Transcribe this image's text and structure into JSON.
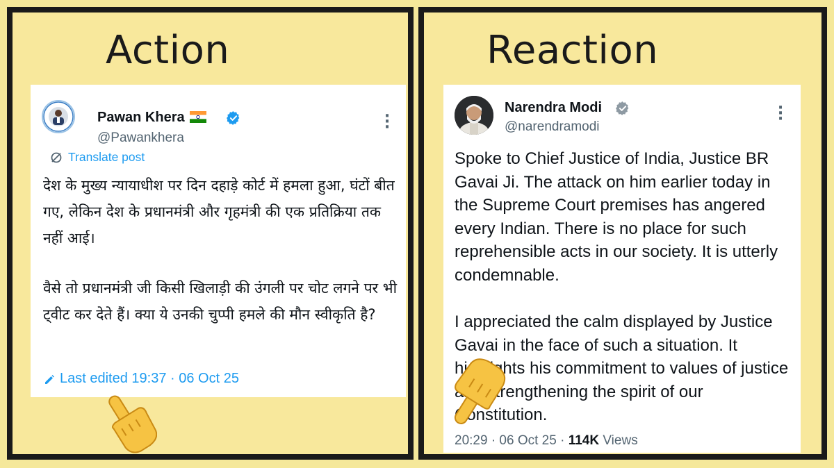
{
  "left": {
    "heading": "Action",
    "tweet": {
      "name": "Pawan Khera",
      "flag_emoji": "🇮🇳",
      "handle": "@Pawankhera",
      "translate_label": "Translate post",
      "paragraphs": [
        "देश के मुख्य न्यायाधीश पर दिन दहाड़े कोर्ट में हमला हुआ, घंटों बीत गए, लेकिन देश के प्रधानमंत्री और गृहमंत्री की एक प्रतिक्रिया तक नहीं आई।",
        "वैसे तो प्रधानमंत्री जी किसी खिलाड़ी की उंगली पर चोट लगने पर भी ट्वीट कर देते हैं। क्या ये उनकी चुप्पी हमले की मौन स्वीकृति है?"
      ],
      "edited_label": "Last edited 19:37 · 06 Oct 25"
    }
  },
  "right": {
    "heading": "Reaction",
    "tweet": {
      "name": "Narendra Modi",
      "handle": "@narendramodi",
      "paragraphs": [
        "Spoke to Chief Justice of India, Justice BR Gavai Ji. The attack on him earlier today in the Supreme Court premises has angered every Indian. There is no place for such reprehensible acts in our society. It is utterly condemnable.",
        "I appreciated the calm displayed by Justice Gavai in the face of such a situation. It highlights his commitment to values of justice and strengthening the spirit of our Constitution."
      ],
      "time": "20:29 · 06 Oct 25 · ",
      "views_count": "114K",
      "views_label": " Views"
    }
  },
  "colors": {
    "background": "#f8e89c",
    "border": "#1a1a1a",
    "twitter_blue": "#1d9bf0",
    "muted_text": "#536471"
  },
  "icons": [
    "verified-badge-icon",
    "translate-icon",
    "pencil-icon",
    "more-options-icon",
    "pointing-hand-icon"
  ]
}
